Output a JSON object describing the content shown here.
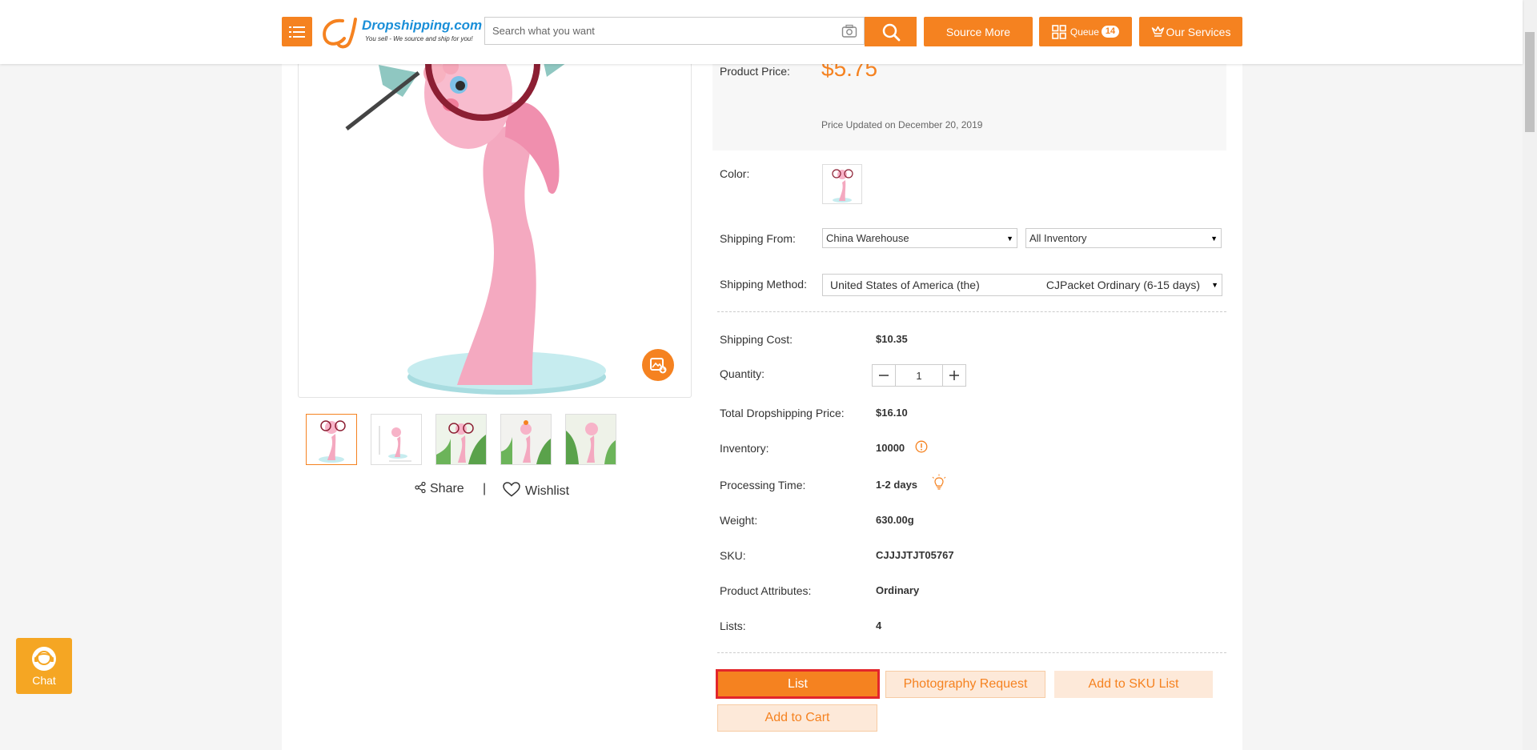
{
  "header": {
    "logo_text": "Dropshipping.com",
    "logo_tagline": "You sell - We source and ship for you!",
    "search_placeholder": "Search what you want",
    "source_more_label": "Source More",
    "queue_label": "Queue",
    "queue_count": "14",
    "our_services_label": "Our Services"
  },
  "product": {
    "price_label": "Product Price:",
    "price": "$5.75",
    "price_updated": "Price Updated on December 20, 2019",
    "color_label": "Color:",
    "shipping_from_label": "Shipping From:",
    "shipping_from_value": "China Warehouse",
    "inventory_filter_value": "All Inventory",
    "shipping_method_label": "Shipping Method:",
    "shipping_country": "United States of America (the)",
    "shipping_method_value": "CJPacket Ordinary (6-15 days)",
    "shipping_cost_label": "Shipping Cost:",
    "shipping_cost": "$10.35",
    "quantity_label": "Quantity:",
    "quantity": "1",
    "total_label": "Total Dropshipping Price:",
    "total": "$16.10",
    "inventory_label": "Inventory:",
    "inventory": "10000",
    "processing_label": "Processing Time:",
    "processing": "1-2 days",
    "weight_label": "Weight:",
    "weight": "630.00g",
    "sku_label": "SKU:",
    "sku": "CJJJJTJT05767",
    "attributes_label": "Product Attributes:",
    "attributes": "Ordinary",
    "lists_label": "Lists:",
    "lists": "4"
  },
  "gallery": {
    "share_label": "Share",
    "separator": "|",
    "wishlist_label": "Wishlist"
  },
  "actions": {
    "list_label": "List",
    "photography_label": "Photography Request",
    "add_sku_label": "Add to SKU List",
    "add_cart_label": "Add to Cart"
  },
  "chat": {
    "label": "Chat"
  },
  "colors": {
    "accent": "#f58220",
    "highlight_border": "#e3262b"
  }
}
